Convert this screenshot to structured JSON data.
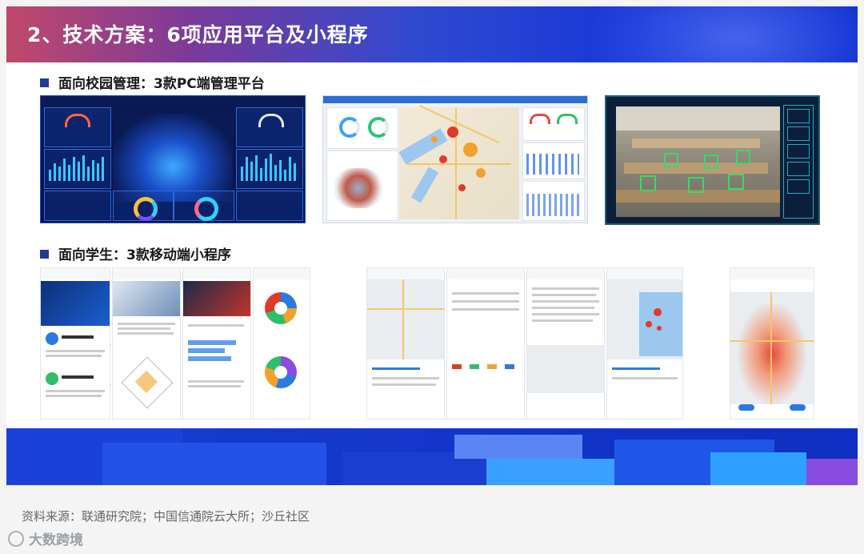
{
  "header": {
    "title": "2、技术方案：6项应用平台及小程序"
  },
  "sections": {
    "pc": "面向校园管理：3款PC端管理平台",
    "mobile": "面向学生：3款移动端小程序"
  },
  "footer": {
    "source": "资料来源：联通研究院；中国信通院云大所；沙丘社区"
  },
  "brand": {
    "logo_text": "大数跨境"
  },
  "colors": {
    "banner_accent": "#1636d8",
    "section_marker": "#1f3c94"
  }
}
